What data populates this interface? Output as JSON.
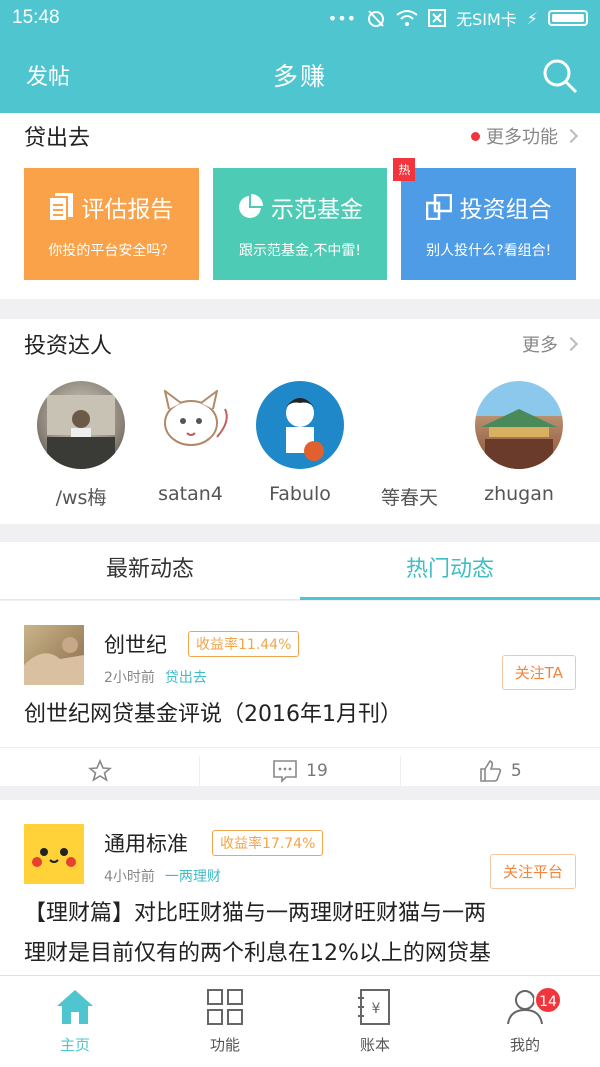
{
  "status": {
    "time": "15:48",
    "carrier": "无SIM卡"
  },
  "nav": {
    "left": "发帖",
    "title": "多赚"
  },
  "lend": {
    "title": "贷出去",
    "more": "更多功能",
    "cards": [
      {
        "title": "评估报告",
        "sub": "你投的平台安全吗？",
        "color": "#f9a24a",
        "icon": "report-icon"
      },
      {
        "title": "示范基金",
        "sub": "跟示范基金,不中雷!",
        "color": "#4ecbb4",
        "icon": "pie-icon"
      },
      {
        "title": "投资组合",
        "sub": "别人投什么?看组合!",
        "color": "#4f9ce6",
        "icon": "portfolio-icon",
        "hot": "热"
      }
    ]
  },
  "experts": {
    "title": "投资达人",
    "more": "更多",
    "list": [
      {
        "name": "/ws梅"
      },
      {
        "name": "satan4"
      },
      {
        "name": "Fabulo"
      },
      {
        "name": "等春天"
      },
      {
        "name": "zhugan"
      }
    ]
  },
  "tabs": [
    "最新动态",
    "热门动态"
  ],
  "posts": [
    {
      "author": "创世纪",
      "yield": "收益率11.44%",
      "time": "2小时前",
      "category": "贷出去",
      "follow": "关注TA",
      "text": "创世纪网贷基金评说（2016年1月刊）",
      "comments": "19",
      "likes": "5"
    },
    {
      "author": "通用标准",
      "yield": "收益率17.74%",
      "time": "4小时前",
      "category": "一两理财",
      "follow": "关注平台",
      "text_line1": "【理财篇】对比旺财猫与一两理财旺财猫与一两",
      "text_line2": "理财是目前仅有的两个利息在12%以上的网贷基"
    }
  ],
  "bottom": [
    {
      "label": "主页",
      "icon": "home-icon"
    },
    {
      "label": "功能",
      "icon": "grid-icon"
    },
    {
      "label": "账本",
      "icon": "ledger-icon"
    },
    {
      "label": "我的",
      "icon": "user-icon",
      "badge": "14"
    }
  ],
  "colors": {
    "accent": "#4fc5cf",
    "badge": "#f2353d",
    "yield": "#f3a64a"
  }
}
